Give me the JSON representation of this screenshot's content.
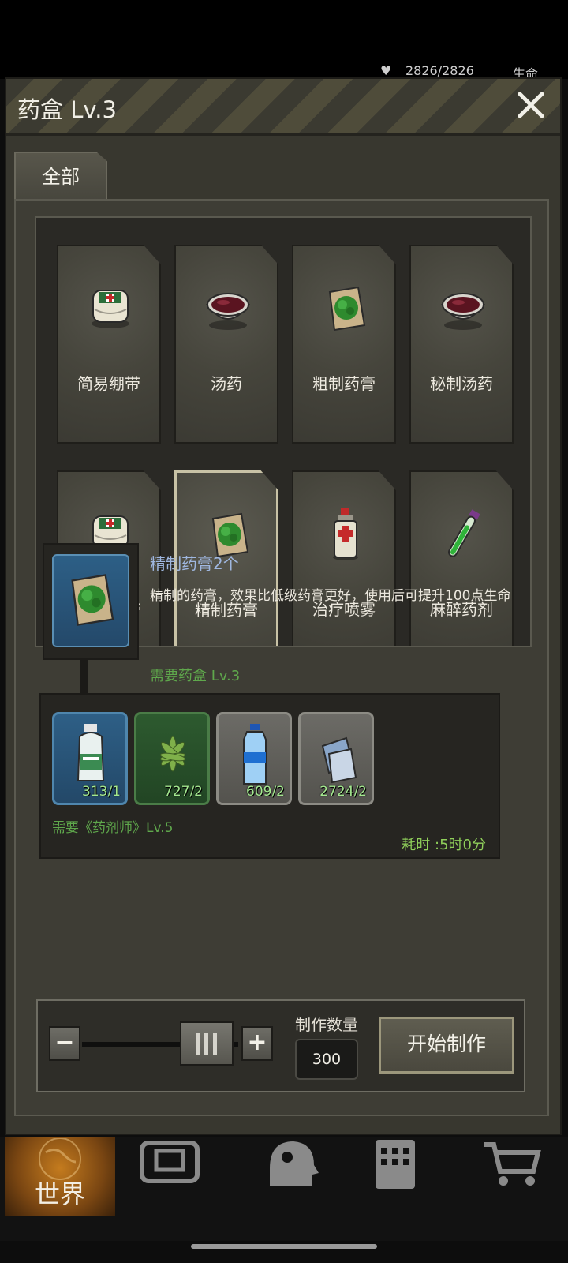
{
  "status_bar": {
    "hp": "2826/2826",
    "hp_label": "生命"
  },
  "window": {
    "title": "药盒 Lv.3"
  },
  "tabs": [
    {
      "label": "全部"
    }
  ],
  "recipes": [
    {
      "name": "简易绷带",
      "icon": "bandage-icon"
    },
    {
      "name": "汤药",
      "icon": "soup-bowl-icon"
    },
    {
      "name": "粗制药膏",
      "icon": "ointment-icon"
    },
    {
      "name": "秘制汤药",
      "icon": "soup-bowl-icon"
    },
    {
      "name": "精制绷带",
      "icon": "bandage-icon"
    },
    {
      "name": "精制药膏",
      "icon": "ointment-icon",
      "selected": true
    },
    {
      "name": "治疗喷雾",
      "icon": "spray-icon"
    },
    {
      "name": "麻醉药剂",
      "icon": "test-tube-icon"
    }
  ],
  "detail": {
    "name": "精制药膏2个",
    "description": "精制的药膏，效果比低级药膏更好，使用后可提升100点生命",
    "requires_level": "需要药盒 Lv.3",
    "requires_skill": "需要《药剂师》Lv.5",
    "time_cost": "耗时 :5时0分",
    "materials": [
      {
        "icon": "medicine-bottle-icon",
        "count": "313/1",
        "rarity": "blue"
      },
      {
        "icon": "herb-leaf-icon",
        "count": "727/2",
        "rarity": "green"
      },
      {
        "icon": "water-bottle-icon",
        "count": "609/2",
        "rarity": "gray"
      },
      {
        "icon": "cloth-icon",
        "count": "2724/2",
        "rarity": "gray"
      }
    ]
  },
  "craft": {
    "quantity_label": "制作数量",
    "quantity": "300",
    "quantity_fraction": 0.65,
    "start_label": "开始制作"
  },
  "navbar": [
    {
      "label": "世界",
      "icon": "globe-icon",
      "active": true
    },
    {
      "label": "",
      "icon": "backpack-icon"
    },
    {
      "label": "",
      "icon": "head-gear-icon"
    },
    {
      "label": "",
      "icon": "calculator-icon"
    },
    {
      "label": "",
      "icon": "cart-icon"
    }
  ],
  "colors": {
    "accent_green": "#5fa84c",
    "time_green": "#8fcf5a",
    "name_blue": "#9fb7e0",
    "nav_active": "#c47b1e"
  }
}
